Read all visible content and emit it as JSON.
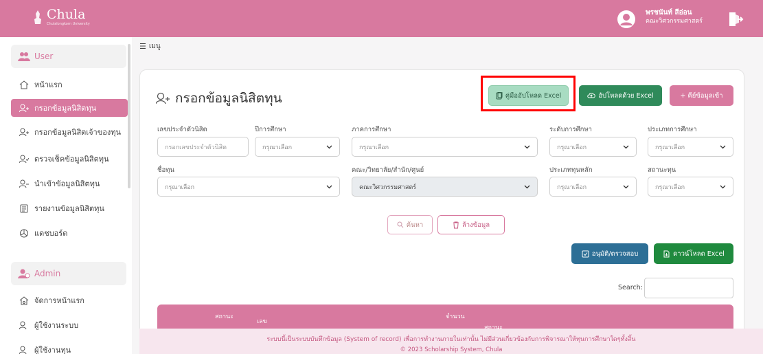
{
  "brand": {
    "name": "Chula",
    "subtitle": "Chulalongkorn University"
  },
  "user": {
    "name": "พรชนันท์ สีอ่อน",
    "department": "คณะวิศวกรรมศาสตร์"
  },
  "sidebar": {
    "user_section": "User",
    "items": [
      {
        "label": "หน้าแรก",
        "icon": "home-icon"
      },
      {
        "label": "กรอกข้อมูลนิสิตทุน",
        "icon": "user-add-icon",
        "active": true
      },
      {
        "label": "กรอกข้อมูลนิสิตเจ้าของทุน",
        "icon": "user-add-icon"
      },
      {
        "label": "ตรวจเช็คข้อมูลนิสิตทุน",
        "icon": "user-check-icon"
      },
      {
        "label": "นำเข้าข้อมูลนิสิตทุน",
        "icon": "user-import-icon"
      },
      {
        "label": "รายงานข้อมูลนิสิตทุน",
        "icon": "report-icon"
      },
      {
        "label": "แดชบอร์ด",
        "icon": "dashboard-icon"
      }
    ],
    "admin_section": "Admin",
    "admin_items": [
      {
        "label": "จัดการหน้าแรก",
        "icon": "home-settings-icon"
      },
      {
        "label": "ผู้ใช้งานระบบ",
        "icon": "user-icon"
      },
      {
        "label": "ผู้ใช้งานทุน",
        "icon": "user-icon"
      }
    ]
  },
  "breadcrumb": {
    "menu_label": "เมนู"
  },
  "page": {
    "title": "กรอกข้อมูลนิสิตทุน"
  },
  "actions": {
    "manual": "คู่มืออัปโหลด Excel",
    "upload": "อัปโหลดด้วย Excel",
    "import": "+ คีย์ข้อมูลเข้า",
    "search": "ค้นหา",
    "clear": "ล้างข้อมูล",
    "approve": "อนุมัติ/ตรวจสอบ",
    "download": "ดาวน์โหลด Excel"
  },
  "form": {
    "student_id": {
      "label": "เลขประจำตัวนิสิต",
      "placeholder": "กรอกเลขประจำตัวนิสิต"
    },
    "academic_year": {
      "label": "ปีการศึกษา",
      "value": "กรุณาเลือก"
    },
    "semester": {
      "label": "ภาคการศึกษา",
      "value": "กรุณาเลือก"
    },
    "education_level": {
      "label": "ระดับการศึกษา",
      "value": "กรุณาเลือก"
    },
    "program_type": {
      "label": "ประเภทการศึกษา",
      "value": "กรุณาเลือก"
    },
    "scholarship_name": {
      "label": "ชื่อทุน",
      "value": "กรุณาเลือก"
    },
    "faculty": {
      "label": "คณะ/วิทยาลัย/สำนัก/ศูนย์",
      "value": "คณะวิศวกรรมศาสตร์"
    },
    "main_type": {
      "label": "ประเภททุนหลัก",
      "value": "กรุณาเลือก"
    },
    "status": {
      "label": "สถานะทุน",
      "value": "กรุณาเลือก"
    }
  },
  "table": {
    "search_label": "Search:",
    "headers": [
      "สถานะ",
      "เลข",
      "จำนวน",
      "สถานะ"
    ]
  },
  "footer": {
    "notice": "ระบบนี้เป็นระบบบันทึกข้อมูล (System of record) เพื่อการทำงานภายในเท่านั้น ไม่มีส่วนเกี่ยวข้องกับการพิจารณาให้ทุนการศึกษาใดๆทั้งสิ้น",
    "copyright": "© 2023 Scholarship System, Chula"
  },
  "colors": {
    "brand_pink": "#d8799f",
    "green": "#2f8a5a",
    "blue": "#2d6f96",
    "highlight": "#ff0000"
  }
}
